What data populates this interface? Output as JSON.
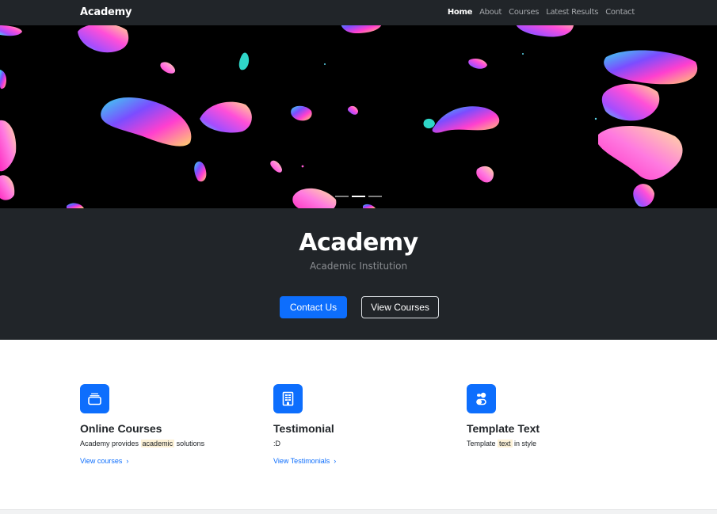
{
  "navbar": {
    "brand": "Academy",
    "links": [
      {
        "label": "Home",
        "active": true
      },
      {
        "label": "About",
        "active": false
      },
      {
        "label": "Courses",
        "active": false
      },
      {
        "label": "Latest Results",
        "active": false
      },
      {
        "label": "Contact",
        "active": false
      }
    ]
  },
  "carousel": {
    "slide_count": 3,
    "active_slide": 2
  },
  "hero": {
    "title": "Academy",
    "subtitle": "Academic Institution",
    "primary_button": "Contact Us",
    "secondary_button": "View Courses"
  },
  "features": [
    {
      "icon": "collection-icon",
      "title": "Online Courses",
      "text_before": "Academy provides ",
      "text_mark": "academic",
      "text_after": " solutions",
      "link": "View courses"
    },
    {
      "icon": "building-icon",
      "title": "Testimonial",
      "text_before": ":D",
      "text_mark": "",
      "text_after": "",
      "link": "View Testimonials"
    },
    {
      "icon": "toggles-icon",
      "title": "Template Text",
      "text_before": "Template ",
      "text_mark": "text",
      "text_after": " in style",
      "link": ""
    }
  ],
  "colors": {
    "primary": "#0d6efd",
    "dark": "#212529",
    "mark": "#fcf1d6"
  }
}
